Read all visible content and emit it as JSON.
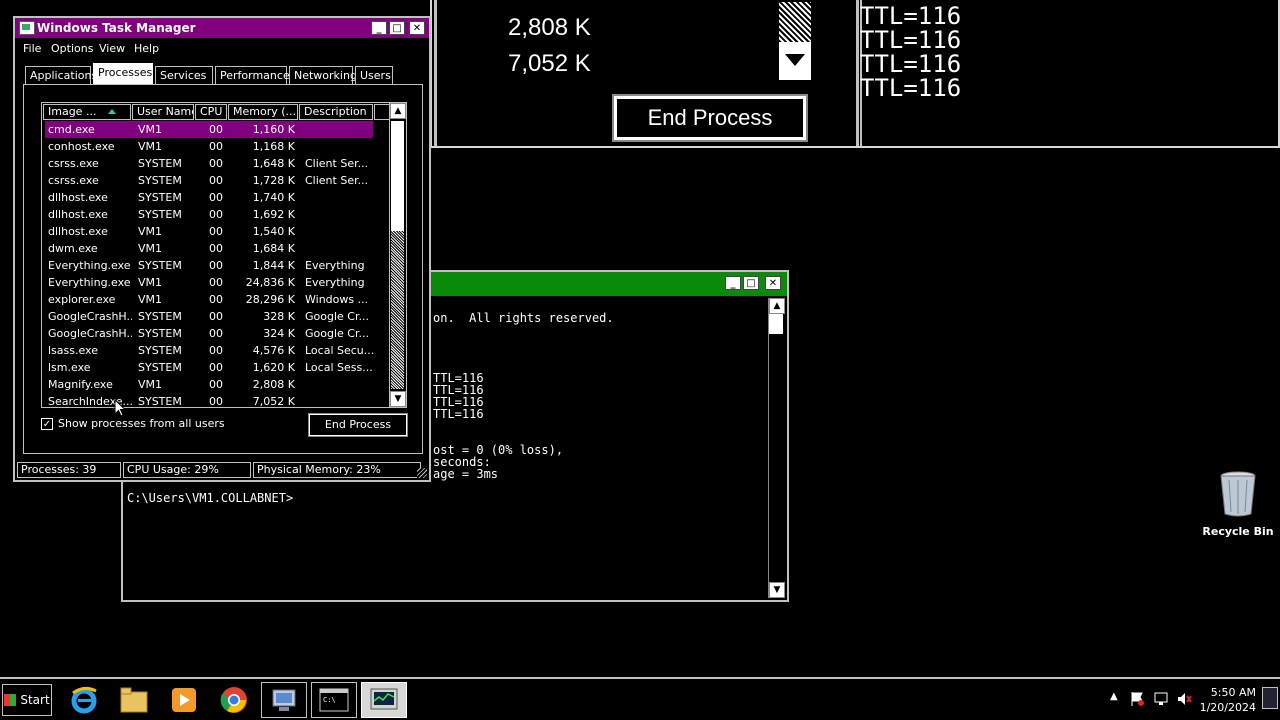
{
  "magnifier": {
    "values": [
      "2,808 K",
      "7,052 K"
    ],
    "end_process": "End Process",
    "ttl_lines": [
      "TTL=116",
      "TTL=116",
      "TTL=116",
      "TTL=116"
    ]
  },
  "console": {
    "lines": [
      "on.  All rights reserved.",
      "TTL=116",
      "TTL=116",
      "TTL=116",
      "TTL=116",
      "ost = 0 (0% loss),",
      "seconds:",
      "age = 3ms",
      "C:\\Users\\VM1.COLLABNET>"
    ]
  },
  "taskman": {
    "title": "Windows Task Manager",
    "menu": [
      "File",
      "Options",
      "View",
      "Help"
    ],
    "tabs": [
      "Applications",
      "Processes",
      "Services",
      "Performance",
      "Networking",
      "Users"
    ],
    "active_tab": "Processes",
    "columns": [
      "Image ...",
      "User Name",
      "CPU",
      "Memory (...",
      "Description"
    ],
    "rows": [
      [
        "cmd.exe",
        "VM1",
        "00",
        "1,160 K",
        ""
      ],
      [
        "conhost.exe",
        "VM1",
        "00",
        "1,168 K",
        ""
      ],
      [
        "csrss.exe",
        "SYSTEM",
        "00",
        "1,648 K",
        "Client Ser..."
      ],
      [
        "csrss.exe",
        "SYSTEM",
        "00",
        "1,728 K",
        "Client Ser..."
      ],
      [
        "dllhost.exe",
        "SYSTEM",
        "00",
        "1,740 K",
        ""
      ],
      [
        "dllhost.exe",
        "SYSTEM",
        "00",
        "1,692 K",
        ""
      ],
      [
        "dllhost.exe",
        "VM1",
        "00",
        "1,540 K",
        ""
      ],
      [
        "dwm.exe",
        "VM1",
        "00",
        "1,684 K",
        ""
      ],
      [
        "Everything.exe",
        "SYSTEM",
        "00",
        "1,844 K",
        "Everything"
      ],
      [
        "Everything.exe",
        "VM1",
        "00",
        "24,836 K",
        "Everything"
      ],
      [
        "explorer.exe",
        "VM1",
        "00",
        "28,296 K",
        "Windows ..."
      ],
      [
        "GoogleCrashH...",
        "SYSTEM",
        "00",
        "328 K",
        "Google Cr..."
      ],
      [
        "GoogleCrashH...",
        "SYSTEM",
        "00",
        "324 K",
        "Google Cr..."
      ],
      [
        "lsass.exe",
        "SYSTEM",
        "00",
        "4,576 K",
        "Local Secu..."
      ],
      [
        "lsm.exe",
        "SYSTEM",
        "00",
        "1,620 K",
        "Local Sess..."
      ],
      [
        "Magnify.exe",
        "VM1",
        "00",
        "2,808 K",
        ""
      ],
      [
        "SearchIndexe...",
        "SYSTEM",
        "00",
        "7,052 K",
        ""
      ]
    ],
    "show_all_users": "Show processes from all users",
    "show_all_checked": true,
    "end_process": "End Process",
    "status": [
      "Processes: 39",
      "CPU Usage: 29%",
      "Physical Memory: 23%"
    ]
  },
  "desktop": {
    "recycle_bin": "Recycle Bin"
  },
  "taskbar": {
    "start": "Start",
    "items": [
      "internet-explorer-icon",
      "file-explorer-icon",
      "media-player-icon",
      "chrome-icon",
      "remote-desktop-icon",
      "command-prompt-icon",
      "task-manager-icon"
    ],
    "time": "5:50 AM",
    "date": "1/20/2024"
  }
}
